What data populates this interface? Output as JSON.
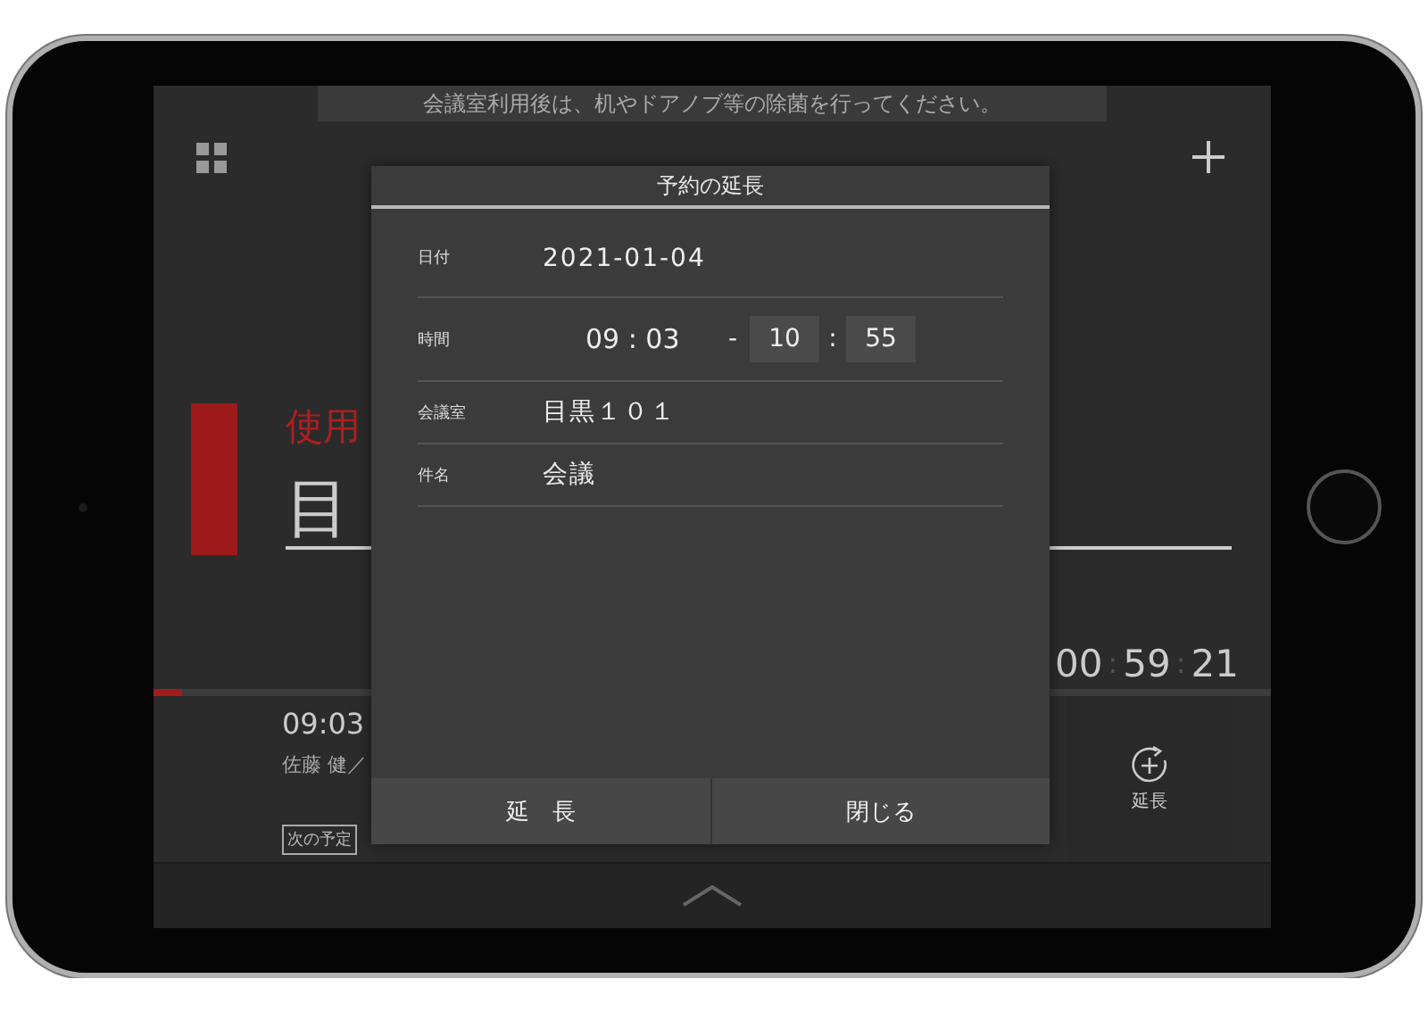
{
  "banner": "会議室利用後は、机やドアノブ等の除菌を行ってください。",
  "status": {
    "label": "使用",
    "room": "目"
  },
  "timer": [
    {
      "kind": "digits",
      "text": "00"
    },
    {
      "kind": "sep",
      "text": ":"
    },
    {
      "kind": "digits",
      "text": "59"
    },
    {
      "kind": "sep",
      "text": ":"
    },
    {
      "kind": "digits",
      "text": "21"
    }
  ],
  "progress": {
    "level": 0.025
  },
  "current": {
    "time": "09:03",
    "organizer": "佐藤 健／",
    "next_badge": "次の予定"
  },
  "actions": [
    {
      "label": "延長"
    }
  ],
  "dialog": {
    "title": "予約の延長",
    "rows": [
      {
        "kind": "text",
        "label": "日付",
        "value": "2021-01-04"
      },
      {
        "kind": "time",
        "label": "時間",
        "start": "09 : 03",
        "dash": "-",
        "end_hour": "10",
        "colon": ":",
        "end_minute": "55"
      },
      {
        "kind": "text",
        "label": "会議室",
        "value": "目黒１０１"
      },
      {
        "kind": "text",
        "label": "件名",
        "value": "会議"
      }
    ],
    "buttons": [
      {
        "label": "延　長"
      },
      {
        "label": "閉じる"
      }
    ]
  }
}
